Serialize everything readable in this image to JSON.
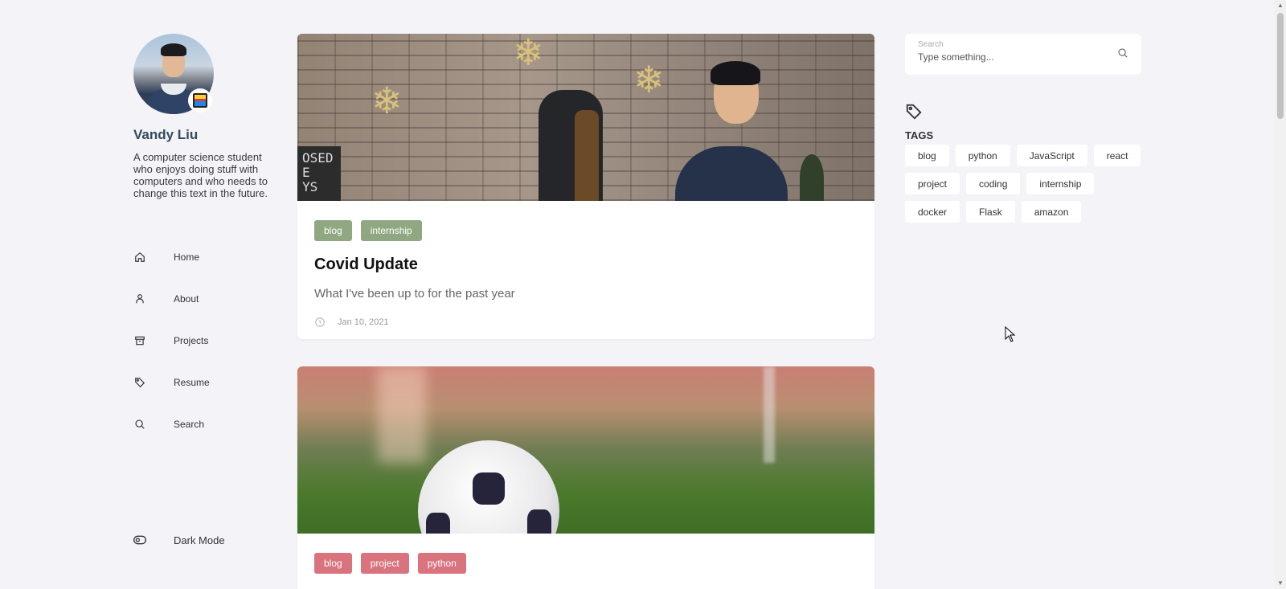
{
  "profile": {
    "name": "Vandy Liu",
    "bio": "A computer science student who enjoys doing stuff with computers and who needs to change this text in the future."
  },
  "nav": {
    "items": [
      {
        "label": "Home",
        "icon": "home-icon"
      },
      {
        "label": "About",
        "icon": "user-icon"
      },
      {
        "label": "Projects",
        "icon": "archive-icon"
      },
      {
        "label": "Resume",
        "icon": "tag-icon"
      },
      {
        "label": "Search",
        "icon": "search-icon"
      }
    ],
    "dark_mode_label": "Dark Mode"
  },
  "posts": [
    {
      "tags": [
        "blog",
        "internship"
      ],
      "title": "Covid Update",
      "subtitle": "What I've been up to for the past year",
      "date": "Jan 10, 2021",
      "tag_color": "#8fa882",
      "hero_sign": "OSED\nE\nYS"
    },
    {
      "tags": [
        "blog",
        "project",
        "python"
      ],
      "tag_color": "#d9747e"
    }
  ],
  "search": {
    "label": "Search",
    "placeholder": "Type something..."
  },
  "tags_panel": {
    "title": "TAGS",
    "tags": [
      "blog",
      "python",
      "JavaScript",
      "react",
      "project",
      "coding",
      "internship",
      "docker",
      "Flask",
      "amazon"
    ]
  },
  "colors": {
    "background": "#f3f3f8",
    "green_tag": "#8fa882",
    "pink_tag": "#d9747e",
    "name_color": "#34495e"
  }
}
